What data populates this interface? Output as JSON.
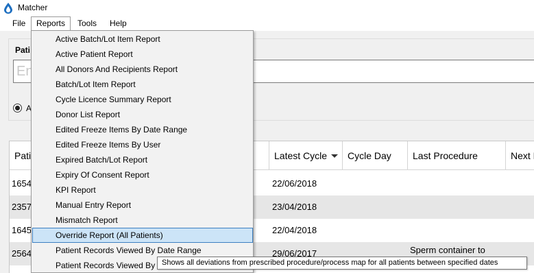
{
  "window": {
    "title": "Matcher"
  },
  "menubar": {
    "items": [
      "File",
      "Reports",
      "Tools",
      "Help"
    ]
  },
  "filter_panel": {
    "label": "Pati",
    "search_placeholder": "En",
    "radio_label": "A"
  },
  "grid": {
    "columns": [
      "Pati",
      "Latest Cycle",
      "Cycle Day",
      "Last Procedure",
      "Next E"
    ],
    "rows": [
      {
        "id": "1654",
        "latest_cycle": "22/06/2018",
        "cycle_day": "",
        "last_procedure": ""
      },
      {
        "id": "2357",
        "latest_cycle": "23/04/2018",
        "cycle_day": "",
        "last_procedure": ""
      },
      {
        "id": "1645",
        "latest_cycle": "22/04/2018",
        "cycle_day": "",
        "last_procedure": ""
      },
      {
        "id": "2564",
        "latest_cycle": "29/06/2017",
        "cycle_day": "",
        "last_procedure": "Sperm container to Thawing dish to Culture"
      }
    ]
  },
  "reports_menu": {
    "items": [
      "Active Batch/Lot Item Report",
      "Active Patient Report",
      "All Donors And Recipients Report",
      "Batch/Lot Item Report",
      "Cycle Licence Summary Report",
      "Donor List Report",
      "Edited Freeze Items By Date Range",
      "Edited Freeze Items By User",
      "Expired Batch/Lot Report",
      "Expiry Of Consent Report",
      "KPI Report",
      "Manual Entry Report",
      "Mismatch Report",
      "Override Report (All Patients)",
      "Patient Records Viewed By Date Range",
      "Patient Records Viewed By User"
    ],
    "highlighted": "Override Report (All Patients)"
  },
  "tooltip": {
    "text": "Shows all deviations from prescribed procedure/process map for all patients between specified dates"
  },
  "colors": {
    "menu_highlight": "#cce4f7",
    "menu_highlight_border": "#3d7fc1",
    "alt_row": "#e6e6e6"
  }
}
